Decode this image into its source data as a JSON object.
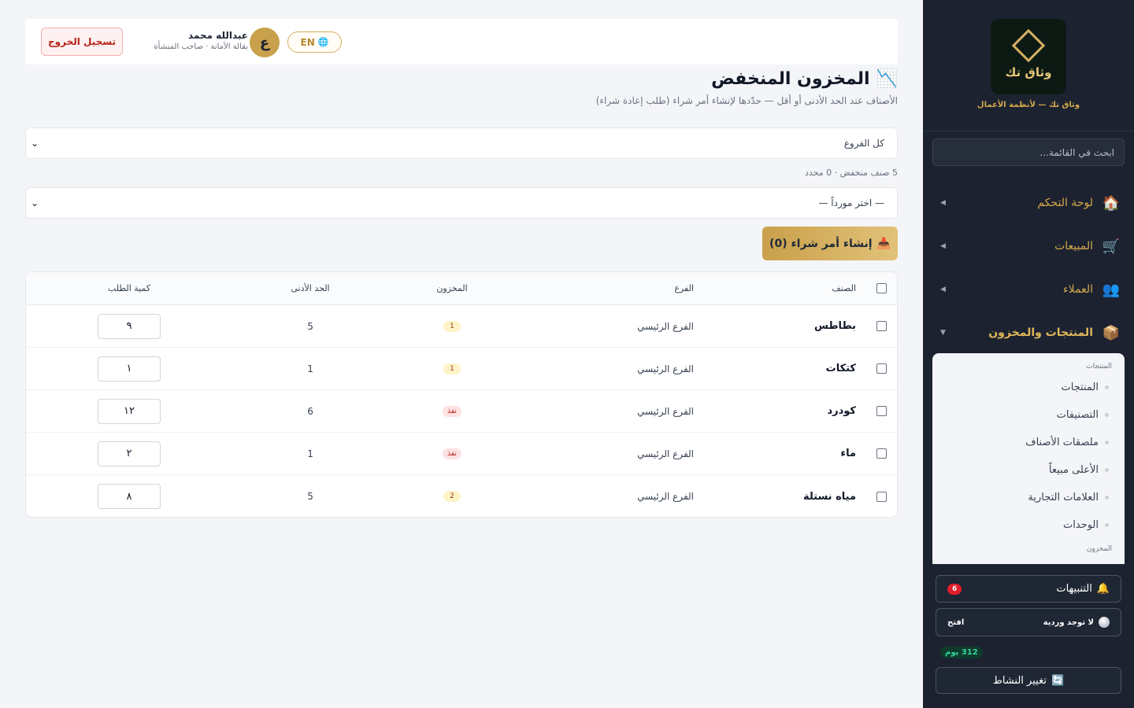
{
  "header": {
    "logout_label": "تسجيل الخروج",
    "user_name": "عبدالله محمد",
    "user_role": "بقالة الأمانة · صاحب المنشأة",
    "avatar_letter": "ع",
    "lang_label": "EN"
  },
  "page": {
    "title": "المخزون المنخفض",
    "subtitle": "الأصناف عند الحد الأدنى أو أقل — حدّدها لإنشاء أمر شراء (طلب إعادة شراء)",
    "branch_select": "كل الفروع",
    "count_text": "5 صنف منخفض · 0 محدد",
    "supplier_select": "— اختر مورداً —",
    "po_button": "إنشاء أمر شراء (0)"
  },
  "table": {
    "columns": {
      "item": "الصنف",
      "branch": "الفرع",
      "stock": "المخزون",
      "min": "الحد الأدنى",
      "qty": "كمية الطلب"
    },
    "rows": [
      {
        "item": "بطاطس",
        "branch": "الفرع الرئيسي",
        "stock": "1",
        "stock_status": "low",
        "min": "5",
        "qty": "٩"
      },
      {
        "item": "كتكات",
        "branch": "الفرع الرئيسي",
        "stock": "1",
        "stock_status": "low",
        "min": "1",
        "qty": "١"
      },
      {
        "item": "كودرد",
        "branch": "الفرع الرئيسي",
        "stock": "نفذ",
        "stock_status": "out",
        "min": "6",
        "qty": "١٢"
      },
      {
        "item": "ماء",
        "branch": "الفرع الرئيسي",
        "stock": "نفذ",
        "stock_status": "out",
        "min": "1",
        "qty": "٢"
      },
      {
        "item": "مياه نستلة",
        "branch": "الفرع الرئيسي",
        "stock": "2",
        "stock_status": "low",
        "min": "5",
        "qty": "٨"
      }
    ]
  },
  "sidebar": {
    "logo_text": "وثاق تك",
    "tagline": "وثاق تك — لأنظمة الأعمال",
    "search_placeholder": "ابحث في القائمة...",
    "nav": [
      {
        "label": "لوحة التحكم",
        "icon": "house-icon"
      },
      {
        "label": "المبيعات",
        "icon": "cart-icon"
      },
      {
        "label": "العملاء",
        "icon": "users-icon"
      },
      {
        "label": "المنتجات والمخزون",
        "icon": "box-icon"
      }
    ],
    "submenu": {
      "heading": "المنتجات",
      "items": [
        "المنتجات",
        "التصنيفات",
        "ملصقات الأصناف",
        "الأعلى مبيعاً",
        "العلامات التجارية",
        "الوحدات"
      ],
      "next_heading": "المخزون"
    },
    "alerts_label": "التنبيهات",
    "alerts_count": "6",
    "shift_label": "لا توجد وردية",
    "shift_action": "افتح",
    "days_label": "312 يوم",
    "switch_label": "تغيير النشاط"
  },
  "colors": {
    "sidebar_bg": "#1c2230",
    "accent_gold": "#d4a94a",
    "danger": "#b42318"
  }
}
